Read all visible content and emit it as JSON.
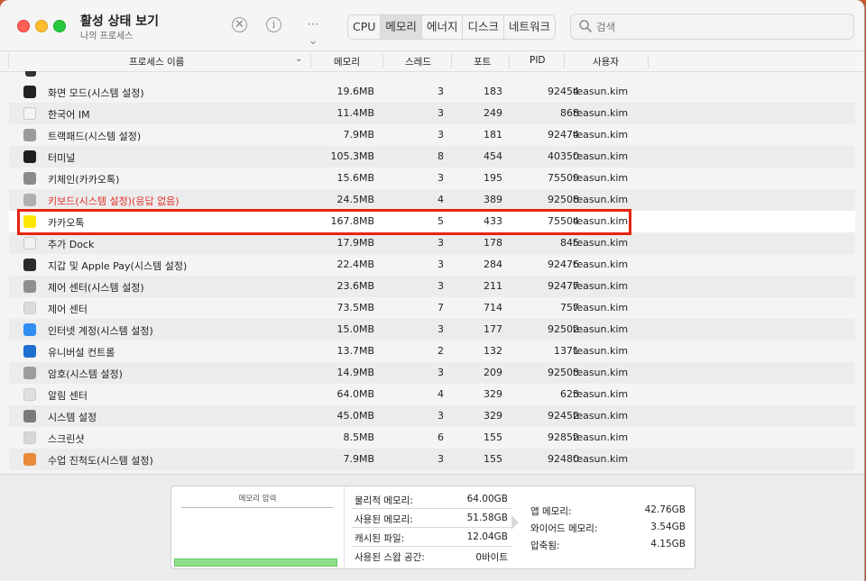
{
  "window": {
    "title": "활성 상태 보기",
    "subtitle": "나의 프로세스"
  },
  "toolbar": {
    "stop_icon": "✕",
    "info_icon": "i",
    "more_icon": "⋯ ⌄",
    "tabs": [
      "CPU",
      "메모리",
      "에너지",
      "디스크",
      "네트워크"
    ],
    "active_tab": "메모리"
  },
  "search": {
    "placeholder": "검색"
  },
  "columns": [
    "프로세스 이름",
    "메모리",
    "스레드",
    "포트",
    "PID",
    "사용자"
  ],
  "rows": [
    {
      "name": "화면 모드(시스템 설정)",
      "mem": "19.6MB",
      "threads": "3",
      "ports": "183",
      "pid": "92454",
      "user": "teasun.kim",
      "icon": "display-icon",
      "color": "#222222"
    },
    {
      "name": "한국어 IM",
      "mem": "11.4MB",
      "threads": "3",
      "ports": "249",
      "pid": "868",
      "user": "teasun.kim",
      "icon": "input-method-icon",
      "color": "#f4f4f4"
    },
    {
      "name": "트랙패드(시스템 설정)",
      "mem": "7.9MB",
      "threads": "3",
      "ports": "181",
      "pid": "92474",
      "user": "teasun.kim",
      "icon": "trackpad-icon",
      "color": "#9a9a9a"
    },
    {
      "name": "터미널",
      "mem": "105.3MB",
      "threads": "8",
      "ports": "454",
      "pid": "40350",
      "user": "teasun.kim",
      "icon": "terminal-icon",
      "color": "#1e1e1e"
    },
    {
      "name": "키체인(카카오톡)",
      "mem": "15.6MB",
      "threads": "3",
      "ports": "195",
      "pid": "75509",
      "user": "teasun.kim",
      "icon": "keychain-icon",
      "color": "#8a8a8a"
    },
    {
      "name": "키보드(시스템 설정)(응답 없음)",
      "mem": "24.5MB",
      "threads": "4",
      "ports": "389",
      "pid": "92508",
      "user": "teasun.kim",
      "icon": "keyboard-icon",
      "color": "#b0b0b0",
      "not_responding": true
    },
    {
      "name": "카카오톡",
      "mem": "167.8MB",
      "threads": "5",
      "ports": "433",
      "pid": "75504",
      "user": "teasun.kim",
      "icon": "kakaotalk-icon",
      "color": "#fee500",
      "selected": true
    },
    {
      "name": "추가 Dock",
      "mem": "17.9MB",
      "threads": "3",
      "ports": "178",
      "pid": "845",
      "user": "teasun.kim",
      "icon": "dock-icon",
      "color": "#f0f0f0"
    },
    {
      "name": "지갑 및 Apple Pay(시스템 설정)",
      "mem": "22.4MB",
      "threads": "3",
      "ports": "284",
      "pid": "92476",
      "user": "teasun.kim",
      "icon": "wallet-icon",
      "color": "#2b2b2b"
    },
    {
      "name": "제어 센터(시스템 설정)",
      "mem": "23.6MB",
      "threads": "3",
      "ports": "211",
      "pid": "92477",
      "user": "teasun.kim",
      "icon": "control-center-settings-icon",
      "color": "#8e8e8e"
    },
    {
      "name": "제어 센터",
      "mem": "73.5MB",
      "threads": "7",
      "ports": "714",
      "pid": "757",
      "user": "teasun.kim",
      "icon": "control-center-icon",
      "color": "#dcdcdc"
    },
    {
      "name": "인터넷 계정(시스템 설정)",
      "mem": "15.0MB",
      "threads": "3",
      "ports": "177",
      "pid": "92502",
      "user": "teasun.kim",
      "icon": "internet-accounts-icon",
      "color": "#2f8cf0"
    },
    {
      "name": "유니버설 컨트롤",
      "mem": "13.7MB",
      "threads": "2",
      "ports": "132",
      "pid": "1371",
      "user": "teasun.kim",
      "icon": "universal-control-icon",
      "color": "#1f6fd1"
    },
    {
      "name": "암호(시스템 설정)",
      "mem": "14.9MB",
      "threads": "3",
      "ports": "209",
      "pid": "92503",
      "user": "teasun.kim",
      "icon": "key-icon",
      "color": "#9c9c9c"
    },
    {
      "name": "알림 센터",
      "mem": "64.0MB",
      "threads": "4",
      "ports": "329",
      "pid": "623",
      "user": "teasun.kim",
      "icon": "notification-center-icon",
      "color": "#e0e0e0"
    },
    {
      "name": "시스템 설정",
      "mem": "45.0MB",
      "threads": "3",
      "ports": "329",
      "pid": "92452",
      "user": "teasun.kim",
      "icon": "gear-icon",
      "color": "#7a7a7a"
    },
    {
      "name": "스크린샷",
      "mem": "8.5MB",
      "threads": "6",
      "ports": "155",
      "pid": "92852",
      "user": "teasun.kim",
      "icon": "screenshot-icon",
      "color": "#d8d8d8"
    },
    {
      "name": "수업 진척도(시스템 설정)",
      "mem": "7.9MB",
      "threads": "3",
      "ports": "155",
      "pid": "92480",
      "user": "teasun.kim",
      "icon": "classroom-icon",
      "color": "#e88a3a"
    }
  ],
  "memory_pressure": {
    "title": "메모리 압력",
    "level": 0.97,
    "color": "#8fe08b"
  },
  "stats": [
    {
      "label": "물리적 메모리:",
      "value": "64.00GB"
    },
    {
      "label": "사용된 메모리:",
      "value": "51.58GB"
    },
    {
      "label": "캐시된 파일:",
      "value": "12.04GB"
    },
    {
      "label": "사용된 스왑 공간:",
      "value": "0바이트"
    }
  ],
  "memory_detail": [
    {
      "label": "앱 메모리:",
      "value": "42.76GB"
    },
    {
      "label": "와이어드 메모리:",
      "value": "3.54GB"
    },
    {
      "label": "압축됨:",
      "value": "4.15GB"
    }
  ],
  "colors": {
    "highlight": "#e5250f",
    "not_responding": "#e0302a"
  }
}
